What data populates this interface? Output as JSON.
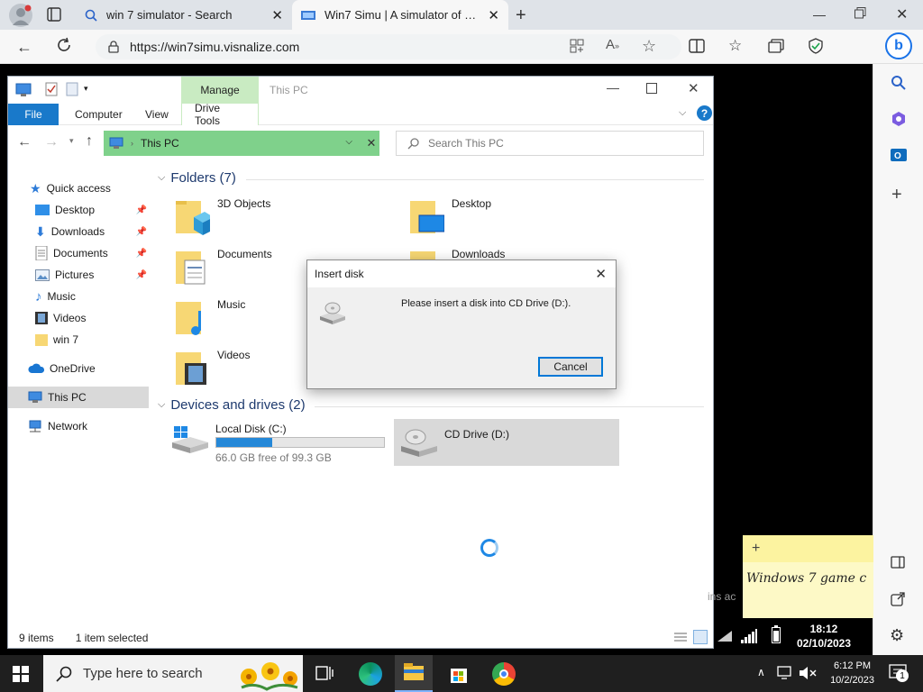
{
  "browser": {
    "tabs": [
      {
        "title": "win 7 simulator - Search"
      },
      {
        "title": "Win7 Simu | A simulator of Windows 7"
      }
    ],
    "url": "https://win7simu.visnalize.com"
  },
  "explorer": {
    "window_title": "This PC",
    "context_tab": "Manage",
    "ribbon_tabs": [
      "File",
      "Computer",
      "View",
      "Drive Tools"
    ],
    "path": "This PC",
    "search_placeholder": "Search This PC",
    "nav": {
      "quick_access": "Quick access",
      "items": [
        "Desktop",
        "Downloads",
        "Documents",
        "Pictures",
        "Music",
        "Videos",
        "win 7"
      ],
      "onedrive": "OneDrive",
      "this_pc": "This PC",
      "network": "Network"
    },
    "folders_header": "Folders (7)",
    "folders": [
      "3D Objects",
      "Desktop",
      "Documents",
      "Downloads",
      "Music",
      "Videos"
    ],
    "devices_header": "Devices and drives (2)",
    "drives": {
      "c_name": "Local Disk (C:)",
      "c_free": "66.0 GB free of 99.3 GB",
      "c_used_fraction": 0.335,
      "d_name": "CD Drive (D:)"
    },
    "status": {
      "items": "9 items",
      "selected": "1 item selected"
    }
  },
  "dialog": {
    "title": "Insert disk",
    "message": "Please insert a disk into CD Drive (D:).",
    "cancel": "Cancel"
  },
  "sticky": {
    "text": "Windows 7 game c",
    "add": "+"
  },
  "bg_text": "ins ac",
  "inner_clock": {
    "time": "18:12",
    "date": "02/10/2023"
  },
  "taskbar": {
    "search_placeholder": "Type here to search",
    "time": "6:12 PM",
    "date": "10/2/2023",
    "notification_count": "1"
  },
  "colors": {
    "accent": "#1979ca",
    "manage": "#c9ebc2",
    "path_bg": "#7fd18b",
    "progress": "#2588d8"
  }
}
